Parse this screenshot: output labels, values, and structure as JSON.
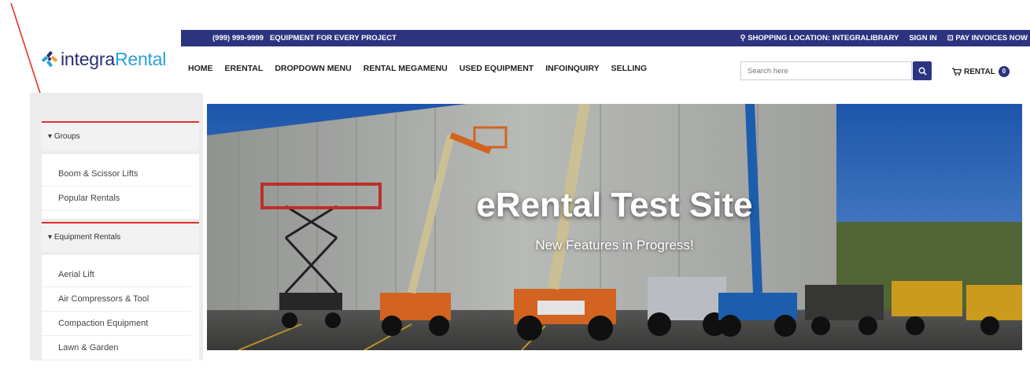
{
  "brand": {
    "name_part1": "integra",
    "name_part2": "Rental",
    "primary_color": "#2c3480",
    "accent_color": "#29a1d8",
    "highlight_color": "#e3302b"
  },
  "topbar": {
    "phone": "(999) 999-9999",
    "tagline": "EQUIPMENT FOR EVERY PROJECT",
    "location": "SHOPPING LOCATION: INTEGRALIBRARY",
    "signin": "SIGN IN",
    "pay": "PAY INVOICES NOW"
  },
  "nav": [
    "HOME",
    "ERENTAL",
    "DROPDOWN MENU",
    "RENTAL MEGAMENU",
    "USED EQUIPMENT",
    "INFOINQUIRY",
    "SELLING"
  ],
  "search": {
    "placeholder": "Search here"
  },
  "cart": {
    "label": "RENTAL",
    "count": "0"
  },
  "sidebar": {
    "groups": {
      "title": "Groups",
      "items": [
        "Boom & Scissor Lifts",
        "Popular Rentals"
      ]
    },
    "equipment": {
      "title": "Equipment Rentals",
      "items": [
        "Aerial Lift",
        "Air Compressors & Tool",
        "Compaction Equipment",
        "Lawn & Garden"
      ]
    }
  },
  "hero": {
    "title": "eRental Test Site",
    "subtitle": "New Features in Progress!"
  }
}
